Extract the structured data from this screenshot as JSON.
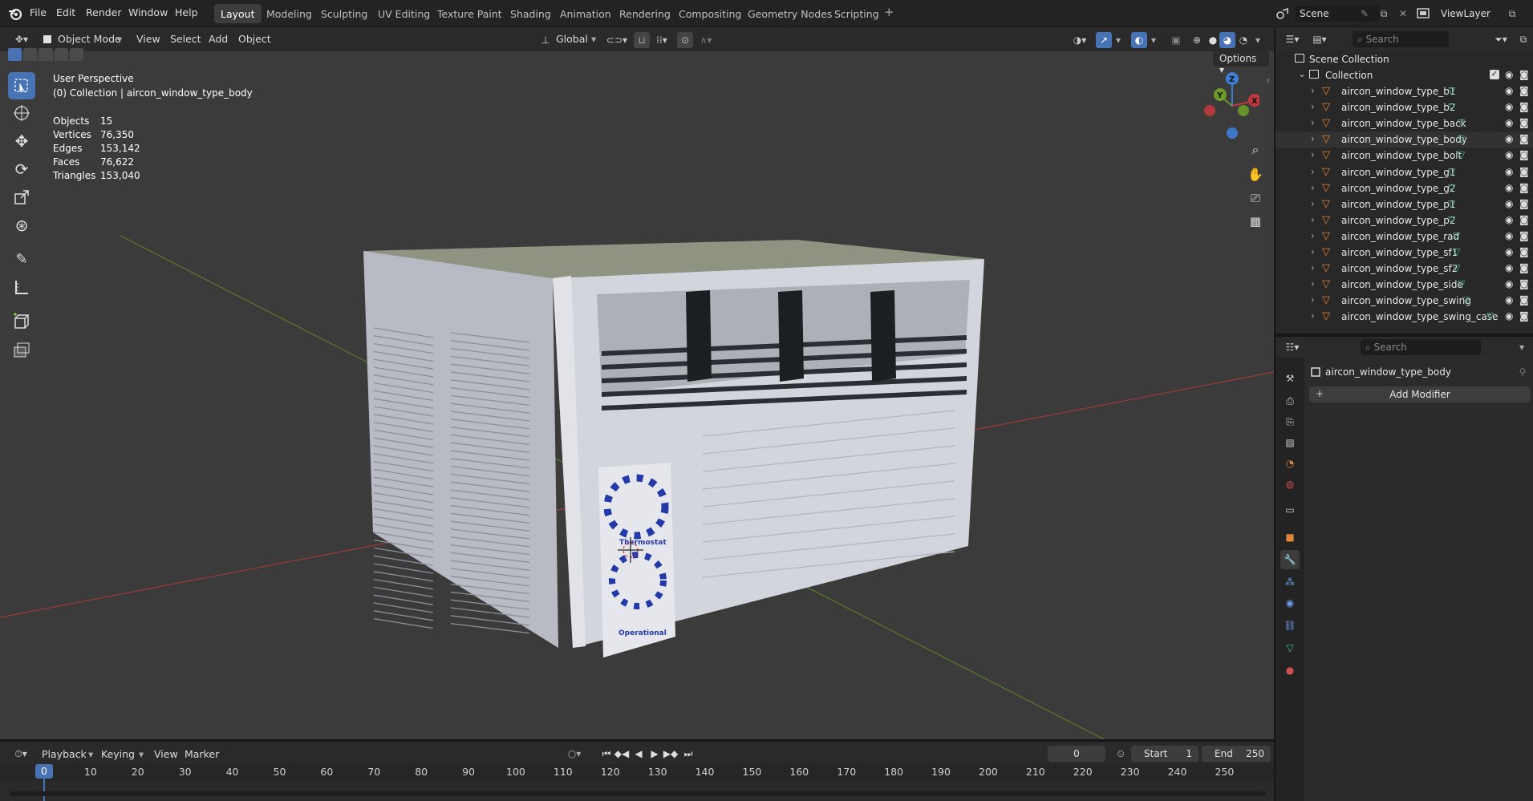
{
  "menus": [
    "File",
    "Edit",
    "Render",
    "Window",
    "Help"
  ],
  "workspaces": [
    "Layout",
    "Modeling",
    "Sculpting",
    "UV Editing",
    "Texture Paint",
    "Shading",
    "Animation",
    "Rendering",
    "Compositing",
    "Geometry Nodes",
    "Scripting"
  ],
  "active_workspace": "Layout",
  "scene": "Scene",
  "view_layer": "ViewLayer",
  "viewport_header": {
    "mode": "Object Mode",
    "menus": [
      "View",
      "Select",
      "Add",
      "Object"
    ],
    "orientation": "Global",
    "options": "Options"
  },
  "overlay": {
    "view_name": "User Perspective",
    "collection_line": "(0) Collection | aircon_window_type_body",
    "stats": [
      {
        "label": "Objects",
        "value": "15"
      },
      {
        "label": "Vertices",
        "value": "76,350"
      },
      {
        "label": "Edges",
        "value": "153,142"
      },
      {
        "label": "Faces",
        "value": "76,622"
      },
      {
        "label": "Triangles",
        "value": "153,040"
      }
    ]
  },
  "gizmo": {
    "x": "X",
    "y": "Y",
    "z": "Z"
  },
  "unit_labels": {
    "thermostat": "Thermostat",
    "operational": "Operational"
  },
  "outliner": {
    "search_placeholder": "Search",
    "scene_collection": "Scene Collection",
    "collection": "Collection",
    "items": [
      "aircon_window_type_b1",
      "aircon_window_type_b2",
      "aircon_window_type_back",
      "aircon_window_type_body",
      "aircon_window_type_bolt",
      "aircon_window_type_g1",
      "aircon_window_type_g2",
      "aircon_window_type_p1",
      "aircon_window_type_p2",
      "aircon_window_type_rad",
      "aircon_window_type_sf1",
      "aircon_window_type_sf2",
      "aircon_window_type_side",
      "aircon_window_type_swing",
      "aircon_window_type_swing_case"
    ],
    "selected_index": 3
  },
  "properties": {
    "search_placeholder": "Search",
    "object_name": "aircon_window_type_body",
    "add_modifier": "Add Modifier"
  },
  "timeline": {
    "menus": [
      "Playback",
      "Keying",
      "View",
      "Marker"
    ],
    "current_frame": "0",
    "start_label": "Start",
    "start": "1",
    "end_label": "End",
    "end": "250",
    "ticks": [
      "0",
      "10",
      "20",
      "30",
      "40",
      "50",
      "60",
      "70",
      "80",
      "90",
      "100",
      "110",
      "120",
      "130",
      "140",
      "150",
      "160",
      "170",
      "180",
      "190",
      "200",
      "210",
      "220",
      "230",
      "240",
      "250"
    ]
  },
  "colors": {
    "accent": "#4772b3",
    "x_axis": "#c0383d",
    "y_axis": "#6d9b2a",
    "z_axis": "#3d7fd6",
    "mesh_icon": "#e0843a",
    "data_icon": "#4fc09a"
  }
}
